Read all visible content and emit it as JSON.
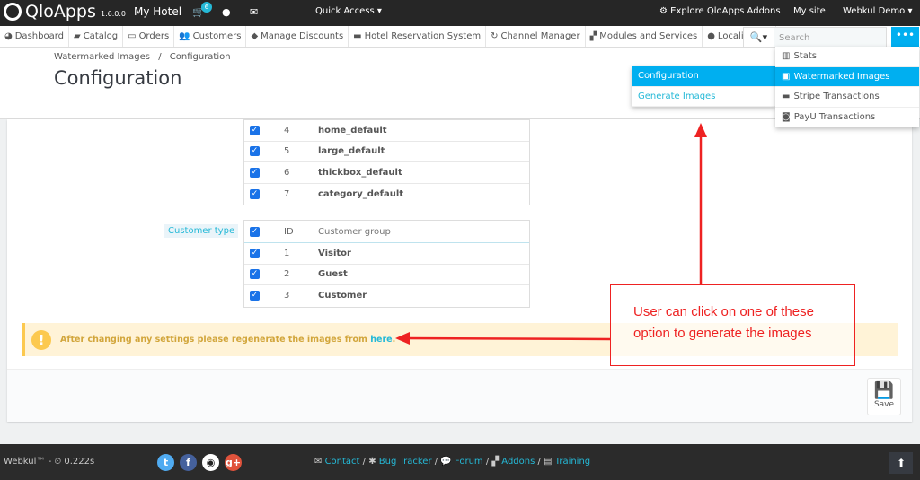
{
  "topbar": {
    "logo": "QloApps",
    "version": "1.6.0.0",
    "shop": "My Hotel",
    "cart_count": "6",
    "quick_access": "Quick Access",
    "explore": "Explore QloApps Addons",
    "my_site": "My site",
    "user": "Webkul Demo"
  },
  "nav": {
    "items": [
      {
        "icon": "dashboard-icon",
        "glyph": "◕",
        "label": "Dashboard"
      },
      {
        "icon": "book-icon",
        "glyph": "▰",
        "label": "Catalog"
      },
      {
        "icon": "credit-card-icon",
        "glyph": "▭",
        "label": "Orders"
      },
      {
        "icon": "users-icon",
        "glyph": "👥",
        "label": "Customers"
      },
      {
        "icon": "tag-icon",
        "glyph": "◆",
        "label": "Manage Discounts"
      },
      {
        "icon": "bed-icon",
        "glyph": "▬",
        "label": "Hotel Reservation System"
      },
      {
        "icon": "refresh-icon",
        "glyph": "↻",
        "label": "Channel Manager"
      },
      {
        "icon": "puzzle-icon",
        "glyph": "▞",
        "label": "Modules and Services"
      },
      {
        "icon": "globe-icon",
        "glyph": "●",
        "label": "Localization"
      }
    ]
  },
  "search": {
    "placeholder": "Search"
  },
  "breadcrumb": {
    "parent": "Watermarked Images",
    "sep": "/",
    "current": "Configuration"
  },
  "page_title": "Configuration",
  "dropdown": {
    "items": [
      {
        "icon": "bar-chart-icon",
        "glyph": "▥",
        "label": "Stats"
      },
      {
        "icon": "image-icon",
        "glyph": "▣",
        "label": "Watermarked Images",
        "active": true
      },
      {
        "icon": "stripe-icon",
        "glyph": "▬",
        "label": "Stripe Transactions"
      },
      {
        "icon": "money-icon",
        "glyph": "◙",
        "label": "PayU Transactions"
      }
    ]
  },
  "submenu": {
    "items": [
      {
        "label": "Configuration",
        "active": true
      },
      {
        "label": "Generate Images"
      }
    ]
  },
  "image_types": {
    "rows": [
      {
        "id": "4",
        "name": "home_default"
      },
      {
        "id": "5",
        "name": "large_default"
      },
      {
        "id": "6",
        "name": "thickbox_default"
      },
      {
        "id": "7",
        "name": "category_default"
      }
    ]
  },
  "customer_type": {
    "label": "Customer type",
    "header": {
      "id": "ID",
      "name": "Customer group"
    },
    "rows": [
      {
        "id": "1",
        "name": "Visitor"
      },
      {
        "id": "2",
        "name": "Guest"
      },
      {
        "id": "3",
        "name": "Customer"
      }
    ]
  },
  "warning": {
    "text": "After changing any settings please regenerate the images from ",
    "link": "here",
    "end": "."
  },
  "annotation": {
    "text": "User can click on one of these option to generate the images",
    "color": "#ee2222"
  },
  "save_label": "Save",
  "footer": {
    "brand": "Webkul™ - ⏲ 0.222s",
    "links": [
      "Contact",
      "Bug Tracker",
      "Forum",
      "Addons",
      "Training"
    ]
  },
  "colors": {
    "accent": "#00aff0",
    "topbar": "#262626",
    "warning_bg": "#fff3d7"
  }
}
